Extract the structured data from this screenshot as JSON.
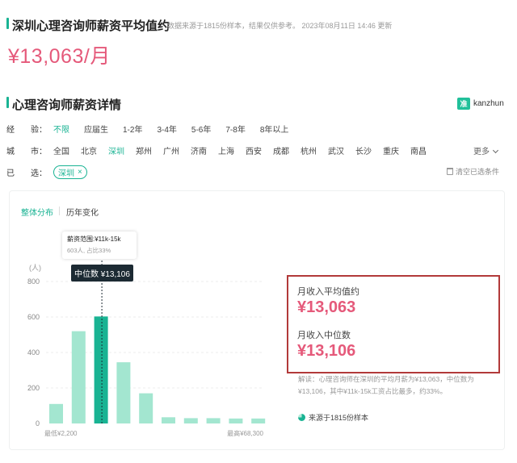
{
  "header": {
    "title": "深圳心理咨询师薪资平均值约",
    "meta": "数据来源于1815份样本，结果仅供参考。    2023年08月11日 14:46 更新",
    "avg_salary": "¥13,063/月"
  },
  "detail": {
    "title": "心理咨询师薪资详情",
    "brand": {
      "logo": "准",
      "name": "kanzhun",
      "icon": "kanzhun-logo-icon"
    }
  },
  "filters": {
    "experience": {
      "label": "经　　验：",
      "options": [
        {
          "text": "不限",
          "selected": true
        },
        {
          "text": "应届生",
          "selected": false
        },
        {
          "text": "1-2年",
          "selected": false
        },
        {
          "text": "3-4年",
          "selected": false
        },
        {
          "text": "5-6年",
          "selected": false
        },
        {
          "text": "7-8年",
          "selected": false
        },
        {
          "text": "8年以上",
          "selected": false
        }
      ]
    },
    "city": {
      "label": "城　　市：",
      "options": [
        {
          "text": "全国",
          "selected": false
        },
        {
          "text": "北京",
          "selected": false
        },
        {
          "text": "深圳",
          "selected": true
        },
        {
          "text": "郑州",
          "selected": false
        },
        {
          "text": "广州",
          "selected": false
        },
        {
          "text": "济南",
          "selected": false
        },
        {
          "text": "上海",
          "selected": false
        },
        {
          "text": "西安",
          "selected": false
        },
        {
          "text": "成都",
          "selected": false
        },
        {
          "text": "杭州",
          "selected": false
        },
        {
          "text": "武汉",
          "selected": false
        },
        {
          "text": "长沙",
          "selected": false
        },
        {
          "text": "重庆",
          "selected": false
        },
        {
          "text": "南昌",
          "selected": false
        }
      ],
      "more": "更多"
    },
    "selected": {
      "label": "已　　选：",
      "tag": "深圳",
      "tag_close": "×",
      "clear": "清空已选条件"
    }
  },
  "tabs": [
    {
      "label": "整体分布",
      "active": true
    },
    {
      "label": "历年变化",
      "active": false
    }
  ],
  "chart_data": {
    "type": "bar",
    "ylabel": "(人)",
    "yticks": [
      0,
      200,
      400,
      600,
      800
    ],
    "ylim": [
      0,
      800
    ],
    "values": [
      110,
      520,
      603,
      345,
      170,
      35,
      30,
      30,
      28,
      28
    ],
    "highlight_index": 2,
    "x_min_label": "最低¥2,200",
    "x_max_label": "最高¥68,300",
    "bar_color": "#a3e6d0",
    "highlight_color": "#19b393",
    "tooltip": {
      "title": "薪资范围:¥11k-15k",
      "sub": "603人, 占比33%"
    },
    "median_label": "中位数 ¥13,106"
  },
  "summary": {
    "avg_label": "月收入平均值约",
    "avg_value": "¥13,063",
    "median_label": "月收入中位数",
    "median_value": "¥13,106",
    "explain": "解读：心理咨询师在深圳的平均月薪为¥13,063，中位数为¥13,106，其中¥11k-15k工资占比最多，约33%。",
    "sample": "来源于1815份样本"
  },
  "colors": {
    "accent": "#19b393",
    "price": "#e5597a",
    "frame": "#b23a3a"
  }
}
